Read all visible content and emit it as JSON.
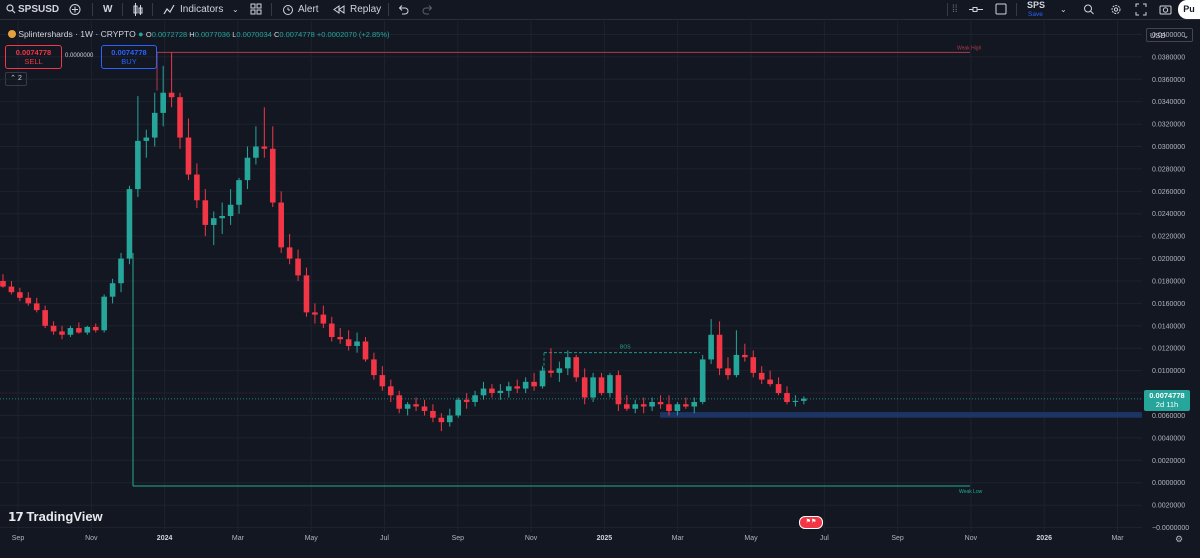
{
  "toolbar": {
    "symbol": "SPSUSD",
    "interval": "W",
    "indicators_label": "Indicators",
    "alert_label": "Alert",
    "replay_label": "Replay",
    "layout_name": "SPS",
    "layout_status": "Save",
    "publish_label": "Pu"
  },
  "legend": {
    "title": "Splintershards · 1W · CRYPTO",
    "open_label": "O",
    "open": "0.0072728",
    "high_label": "H",
    "high": "0.0077036",
    "low_label": "L",
    "low": "0.0070034",
    "close_label": "C",
    "close": "0.0074778",
    "change": "+0.0002070 (+2.85%)",
    "sell_price": "0.0074778",
    "sell_label": "SELL",
    "spread": "0.0000000",
    "buy_price": "0.0074778",
    "buy_label": "BUY",
    "collapse_count": "2"
  },
  "currency": "USD",
  "price_badge": {
    "price": "0.0074778",
    "countdown": "2d 11h"
  },
  "brand": "TradingView",
  "annotations": {
    "high_label": "Weak High",
    "low_label": "Weak Low",
    "bos_label": "BOS"
  },
  "colors": {
    "up": "#26a69a",
    "down": "#f23645",
    "background": "#131722",
    "zone": "#1e3a6e",
    "level_high": "#b2394a",
    "level_low": "#22ab94"
  },
  "chart_data": {
    "type": "candlestick",
    "title": "Splintershards · 1W · CRYPTO",
    "x_ticks": [
      "Sep",
      "Nov",
      "2024",
      "Mar",
      "May",
      "Jul",
      "Sep",
      "Nov",
      "2025",
      "Mar",
      "May",
      "Jul",
      "Sep",
      "Nov",
      "2026",
      "Mar"
    ],
    "y_ticks": [
      "0.0400000",
      "0.0380000",
      "0.0360000",
      "0.0340000",
      "0.0320000",
      "0.0300000",
      "0.0280000",
      "0.0260000",
      "0.0240000",
      "0.0220000",
      "0.0200000",
      "0.0180000",
      "0.0160000",
      "0.0140000",
      "0.0120000",
      "0.0100000",
      "0.0080000",
      "0.0060000",
      "0.0040000",
      "0.0020000",
      "0.0000000",
      "0.0020000",
      "−0.0000000",
      "−0.0020000",
      "−0.0040000"
    ],
    "ylim": [
      -0.0044,
      0.0412
    ],
    "last_price": 0.0074778,
    "levels": [
      {
        "name": "Weak High",
        "value": 0.0384
      },
      {
        "name": "Weak Low",
        "value": -0.0003
      }
    ],
    "zone": {
      "from": 0.0058,
      "to": 0.0063
    },
    "bos_level": 0.0116,
    "candles": [
      [
        0.018,
        0.0186,
        0.0174,
        0.0175
      ],
      [
        0.0175,
        0.018,
        0.0168,
        0.017
      ],
      [
        0.017,
        0.0174,
        0.0162,
        0.0165
      ],
      [
        0.0165,
        0.017,
        0.0158,
        0.016
      ],
      [
        0.016,
        0.0165,
        0.0152,
        0.0154
      ],
      [
        0.0154,
        0.0158,
        0.0138,
        0.014
      ],
      [
        0.014,
        0.0144,
        0.0132,
        0.0135
      ],
      [
        0.0135,
        0.014,
        0.0128,
        0.0132
      ],
      [
        0.0132,
        0.014,
        0.013,
        0.0138
      ],
      [
        0.0138,
        0.0143,
        0.0133,
        0.0134
      ],
      [
        0.0134,
        0.014,
        0.0132,
        0.0139
      ],
      [
        0.0139,
        0.0142,
        0.0134,
        0.0136
      ],
      [
        0.0136,
        0.0168,
        0.0134,
        0.0166
      ],
      [
        0.0166,
        0.0182,
        0.016,
        0.0178
      ],
      [
        0.0178,
        0.0205,
        0.017,
        0.02
      ],
      [
        0.02,
        0.0265,
        0.0195,
        0.0262
      ],
      [
        0.0262,
        0.0345,
        0.0255,
        0.0305
      ],
      [
        0.0305,
        0.0315,
        0.029,
        0.0308
      ],
      [
        0.0308,
        0.0348,
        0.03,
        0.033
      ],
      [
        0.033,
        0.0372,
        0.0318,
        0.0348
      ],
      [
        0.0348,
        0.0384,
        0.0335,
        0.0344
      ],
      [
        0.0344,
        0.0348,
        0.0298,
        0.0308
      ],
      [
        0.0308,
        0.0325,
        0.027,
        0.0275
      ],
      [
        0.0275,
        0.0285,
        0.0245,
        0.0252
      ],
      [
        0.0252,
        0.0262,
        0.022,
        0.023
      ],
      [
        0.023,
        0.0242,
        0.0212,
        0.0236
      ],
      [
        0.0236,
        0.025,
        0.0222,
        0.0238
      ],
      [
        0.0238,
        0.0262,
        0.023,
        0.0248
      ],
      [
        0.0248,
        0.0272,
        0.024,
        0.027
      ],
      [
        0.027,
        0.03,
        0.0262,
        0.029
      ],
      [
        0.029,
        0.0318,
        0.0284,
        0.03
      ],
      [
        0.03,
        0.0335,
        0.029,
        0.0298
      ],
      [
        0.0298,
        0.0318,
        0.0246,
        0.025
      ],
      [
        0.025,
        0.026,
        0.0205,
        0.021
      ],
      [
        0.021,
        0.0222,
        0.0195,
        0.02
      ],
      [
        0.02,
        0.0208,
        0.018,
        0.0185
      ],
      [
        0.0185,
        0.0192,
        0.0148,
        0.0152
      ],
      [
        0.0152,
        0.016,
        0.0142,
        0.015
      ],
      [
        0.015,
        0.0158,
        0.0138,
        0.0142
      ],
      [
        0.0142,
        0.0148,
        0.0126,
        0.013
      ],
      [
        0.013,
        0.0138,
        0.0124,
        0.0128
      ],
      [
        0.0128,
        0.0136,
        0.0118,
        0.0122
      ],
      [
        0.0122,
        0.0134,
        0.0116,
        0.0126
      ],
      [
        0.0126,
        0.013,
        0.0108,
        0.011
      ],
      [
        0.011,
        0.0116,
        0.0092,
        0.0096
      ],
      [
        0.0096,
        0.0104,
        0.0082,
        0.0086
      ],
      [
        0.0086,
        0.0092,
        0.0072,
        0.0078
      ],
      [
        0.0078,
        0.0082,
        0.0062,
        0.0066
      ],
      [
        0.0066,
        0.0072,
        0.006,
        0.007
      ],
      [
        0.007,
        0.0076,
        0.0064,
        0.0068
      ],
      [
        0.0068,
        0.0074,
        0.006,
        0.0064
      ],
      [
        0.0064,
        0.007,
        0.0054,
        0.0058
      ],
      [
        0.0058,
        0.0062,
        0.0046,
        0.0054
      ],
      [
        0.0054,
        0.0066,
        0.005,
        0.006
      ],
      [
        0.006,
        0.0076,
        0.0058,
        0.0074
      ],
      [
        0.0074,
        0.008,
        0.0066,
        0.0072
      ],
      [
        0.0072,
        0.0082,
        0.0068,
        0.0078
      ],
      [
        0.0078,
        0.009,
        0.0074,
        0.0084
      ],
      [
        0.0084,
        0.0088,
        0.0076,
        0.008
      ],
      [
        0.008,
        0.0088,
        0.0074,
        0.0082
      ],
      [
        0.0082,
        0.009,
        0.0076,
        0.0086
      ],
      [
        0.0086,
        0.0092,
        0.008,
        0.0084
      ],
      [
        0.0084,
        0.0094,
        0.008,
        0.009
      ],
      [
        0.009,
        0.0098,
        0.0082,
        0.0086
      ],
      [
        0.0086,
        0.0104,
        0.0084,
        0.01
      ],
      [
        0.01,
        0.012,
        0.0094,
        0.0098
      ],
      [
        0.0098,
        0.0108,
        0.009,
        0.0102
      ],
      [
        0.0102,
        0.0118,
        0.0096,
        0.0112
      ],
      [
        0.0112,
        0.0114,
        0.009,
        0.0094
      ],
      [
        0.0094,
        0.0102,
        0.007,
        0.0076
      ],
      [
        0.0076,
        0.0098,
        0.0072,
        0.0094
      ],
      [
        0.0094,
        0.0098,
        0.0078,
        0.008
      ],
      [
        0.008,
        0.0098,
        0.0076,
        0.0096
      ],
      [
        0.0096,
        0.01,
        0.0064,
        0.007
      ],
      [
        0.007,
        0.0078,
        0.0064,
        0.0066
      ],
      [
        0.0066,
        0.0074,
        0.0062,
        0.007
      ],
      [
        0.007,
        0.0076,
        0.0062,
        0.0068
      ],
      [
        0.0068,
        0.0076,
        0.0064,
        0.0072
      ],
      [
        0.0072,
        0.0078,
        0.0066,
        0.007
      ],
      [
        0.007,
        0.0078,
        0.006,
        0.0064
      ],
      [
        0.0064,
        0.0072,
        0.006,
        0.007
      ],
      [
        0.007,
        0.0076,
        0.0066,
        0.0068
      ],
      [
        0.0068,
        0.0076,
        0.0062,
        0.0072
      ],
      [
        0.0072,
        0.0114,
        0.007,
        0.011
      ],
      [
        0.011,
        0.0146,
        0.0106,
        0.0132
      ],
      [
        0.0132,
        0.0144,
        0.0096,
        0.0102
      ],
      [
        0.0102,
        0.0112,
        0.0092,
        0.0096
      ],
      [
        0.0096,
        0.0136,
        0.0094,
        0.0114
      ],
      [
        0.0114,
        0.0124,
        0.0108,
        0.0112
      ],
      [
        0.0112,
        0.0118,
        0.0094,
        0.0098
      ],
      [
        0.0098,
        0.0104,
        0.0088,
        0.0092
      ],
      [
        0.0092,
        0.01,
        0.0086,
        0.0088
      ],
      [
        0.0088,
        0.0094,
        0.0078,
        0.008
      ],
      [
        0.008,
        0.0086,
        0.007,
        0.0072
      ],
      [
        0.0072,
        0.0078,
        0.0068,
        0.0073
      ],
      [
        0.0073,
        0.0077,
        0.007,
        0.0075
      ]
    ]
  }
}
